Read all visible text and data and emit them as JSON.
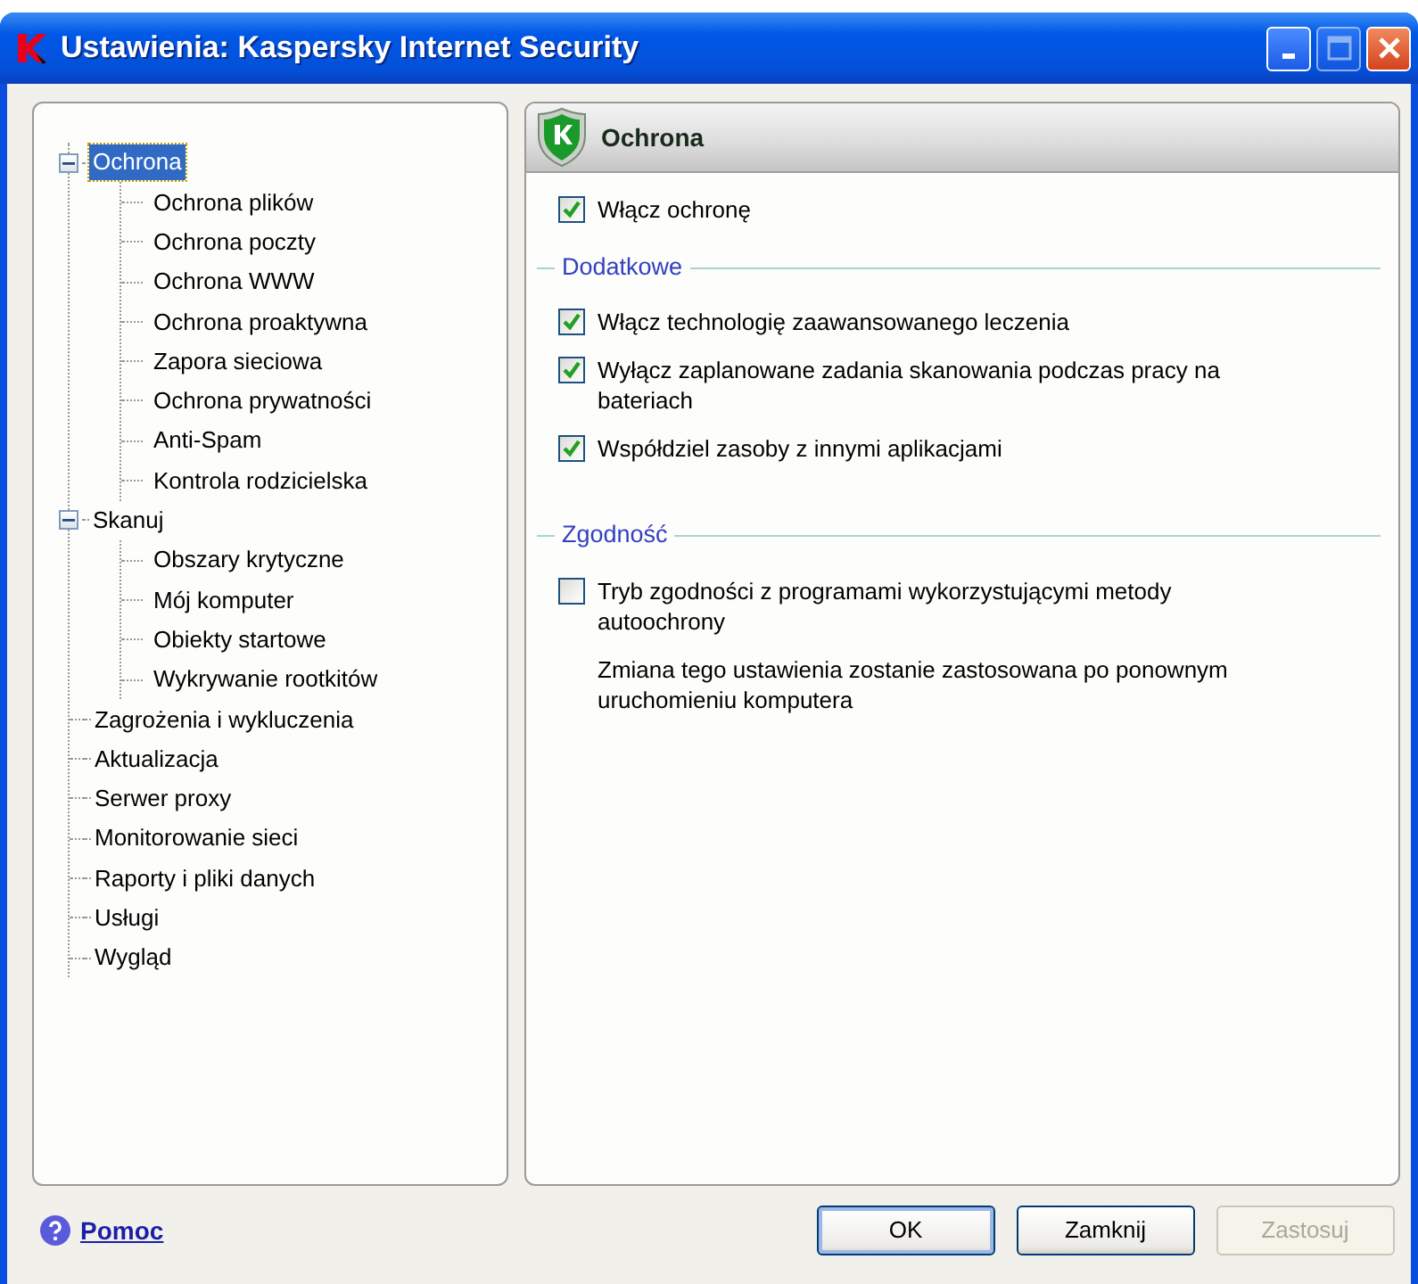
{
  "window": {
    "title": "Ustawienia: Kaspersky Internet Security",
    "maximize_disabled": true
  },
  "tree": [
    {
      "label": "Ochrona",
      "selected": true,
      "expanded": true,
      "children": [
        {
          "label": "Ochrona plików",
          "selected": false
        },
        {
          "label": "Ochrona poczty",
          "selected": false
        },
        {
          "label": "Ochrona WWW",
          "selected": false
        },
        {
          "label": "Ochrona proaktywna",
          "selected": false
        },
        {
          "label": "Zapora sieciowa",
          "selected": false
        },
        {
          "label": "Ochrona prywatności",
          "selected": false
        },
        {
          "label": "Anti-Spam",
          "selected": false
        },
        {
          "label": "Kontrola rodzicielska",
          "selected": false
        }
      ]
    },
    {
      "label": "Skanuj",
      "selected": false,
      "expanded": true,
      "children": [
        {
          "label": "Obszary krytyczne",
          "selected": false
        },
        {
          "label": "Mój komputer",
          "selected": false
        },
        {
          "label": "Obiekty startowe",
          "selected": false
        },
        {
          "label": "Wykrywanie rootkitów",
          "selected": false
        }
      ]
    },
    {
      "label": "Zagrożenia i wykluczenia",
      "selected": false
    },
    {
      "label": "Aktualizacja",
      "selected": false
    },
    {
      "label": "Serwer proxy",
      "selected": false
    },
    {
      "label": "Monitorowanie sieci",
      "selected": false
    },
    {
      "label": "Raporty i pliki danych",
      "selected": false
    },
    {
      "label": "Usługi",
      "selected": false
    },
    {
      "label": "Wygląd",
      "selected": false
    }
  ],
  "panel": {
    "title": "Ochrona",
    "items": [
      {
        "kind": "checkbox",
        "label": "Włącz ochronę",
        "checked": true
      },
      {
        "kind": "section",
        "title": "Dodatkowe"
      },
      {
        "kind": "checkbox",
        "label": "Włącz technologię zaawansowanego leczenia",
        "checked": true
      },
      {
        "kind": "checkbox",
        "label": "Wyłącz zaplanowane zadania skanowania podczas pracy na bateriach",
        "checked": true
      },
      {
        "kind": "checkbox",
        "label": "Współdziel zasoby z innymi aplikacjami",
        "checked": true
      },
      {
        "kind": "section",
        "title": "Zgodność"
      },
      {
        "kind": "checkbox",
        "label": "Tryb zgodności z programami wykorzystującymi metody autoochrony",
        "checked": false
      },
      {
        "kind": "note",
        "text": "Zmiana tego ustawienia zostanie zastosowana po ponownym uruchomieniu komputera"
      }
    ]
  },
  "footer": {
    "help_link": "Pomoc",
    "buttons": [
      {
        "label": "OK",
        "default": true,
        "disabled": false
      },
      {
        "label": "Zamknij",
        "default": false,
        "disabled": false
      },
      {
        "label": "Zastosuj",
        "default": false,
        "disabled": true
      }
    ]
  }
}
